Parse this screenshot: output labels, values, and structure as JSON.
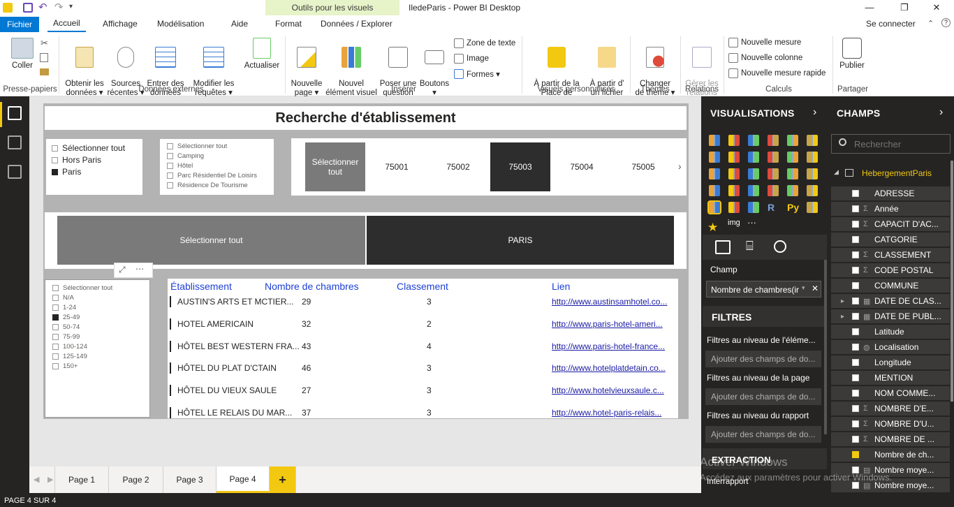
{
  "window": {
    "title": "IledeParis - Power BI Desktop",
    "sign_in": "Se connecter",
    "contextual_group": "Outils pour les visuels"
  },
  "ribbon_tabs": [
    "Fichier",
    "Accueil",
    "Affichage",
    "Modélisation",
    "Aide",
    "Format",
    "Données / Explorer"
  ],
  "ribbon": {
    "coller": "Coller",
    "obtenir": "Obtenir les\ndonnées ▾",
    "sources": "Sources\nrécentes ▾",
    "entrer": "Entrer des\ndonnées",
    "modifier": "Modifier les\nrequêtes ▾",
    "actualiser": "Actualiser",
    "nouvelle_page": "Nouvelle\npage ▾",
    "nouvel_element": "Nouvel\nélément visuel",
    "poser": "Poser une\nquestion",
    "boutons": "Boutons\n▾",
    "zone_texte": "Zone de texte",
    "image": "Image",
    "formes": "Formes ▾",
    "place_marche": "À partir de la\nPlace de marché",
    "fichier": "À partir d'\nun fichier",
    "changer_theme": "Changer\nde thème ▾",
    "gerer_relations": "Gérer les\nrelations",
    "nouvelle_mesure": "Nouvelle mesure",
    "nouvelle_colonne": "Nouvelle colonne",
    "mesure_rapide": "Nouvelle mesure rapide",
    "publier": "Publier",
    "groups": {
      "presse": "Presse-papiers",
      "donnees": "Données externes",
      "inserer": "Insérer",
      "visuels": "Visuels personnalisés",
      "themes": "Thèmes",
      "relations": "Relations",
      "calculs": "Calculs",
      "partager": "Partager"
    }
  },
  "report": {
    "title": "Recherche d'établissement",
    "slicer_zone": [
      "Sélectionner tout",
      "Hors Paris",
      "Paris"
    ],
    "slicer_type": [
      "Sélectionner tout",
      "Camping",
      "Hôtel",
      "Parc Résidentiel De Loisirs",
      "Résidence De Tourisme"
    ],
    "postal_buttons": [
      "Sélectionner tout",
      "75001",
      "75002",
      "75003",
      "75004",
      "75005"
    ],
    "city_buttons": [
      "Sélectionner tout",
      "PARIS"
    ],
    "slicer_rooms": [
      "Sélectionner tout",
      "N/A",
      "1-24",
      "25-49",
      "50-74",
      "75-99",
      "100-124",
      "125-149",
      "150+"
    ],
    "table": {
      "headers": [
        "Établissement",
        "Nombre de chambres",
        "Classement",
        "Lien"
      ],
      "rows": [
        {
          "name": "AUSTIN'S ARTS ET MϹTIER...",
          "rooms": "29",
          "rank": "3",
          "link": "http://www.austinsamhotel.co..."
        },
        {
          "name": "HOTEL AMERICAIN",
          "rooms": "32",
          "rank": "2",
          "link": "http://www.paris-hotel-ameri..."
        },
        {
          "name": "HÔTEL BEST WESTERN FRA...",
          "rooms": "43",
          "rank": "4",
          "link": "http://www.paris-hotel-france..."
        },
        {
          "name": "HÔTEL DU PLAT D'ϹTAIN",
          "rooms": "46",
          "rank": "3",
          "link": "http://www.hotelplatdetain.co..."
        },
        {
          "name": "HÔTEL DU VIEUX SAULE",
          "rooms": "27",
          "rank": "3",
          "link": "http://www.hotelvieuxsaule.c..."
        },
        {
          "name": "HÔTEL LE RELAIS DU MAR...",
          "rooms": "37",
          "rank": "3",
          "link": "http://www.hotel-paris-relais..."
        }
      ]
    }
  },
  "pages": [
    "Page 1",
    "Page 2",
    "Page 3",
    "Page 4"
  ],
  "add_page": "+",
  "status": "PAGE 4 SUR 4",
  "viz_pane": {
    "title": "VISUALISATIONS",
    "img_label": "img",
    "more": "···",
    "champ_label": "Champ",
    "champ_value": "Nombre de chambres(ir",
    "filters_title": "FILTRES",
    "filter_visual": "Filtres au niveau de l'éléme...",
    "filter_page": "Filtres au niveau de la page",
    "filter_report": "Filtres au niveau du rapport",
    "add_fields": "Ajouter des champs de do...",
    "extraction": "EXTRACTION",
    "interrapport": "Interrapport"
  },
  "fields_pane": {
    "title": "CHAMPS",
    "search_placeholder": "Rechercher",
    "table_name": "HebergementParis",
    "fields": [
      {
        "name": "ADRESSE",
        "sigma": "",
        "checked": false
      },
      {
        "name": "Année",
        "sigma": "Σ",
        "checked": false
      },
      {
        "name": "CAPACIT D'AC...",
        "sigma": "Σ",
        "checked": false
      },
      {
        "name": "CATGORIE",
        "sigma": "",
        "checked": false
      },
      {
        "name": "CLASSEMENT",
        "sigma": "Σ",
        "checked": false
      },
      {
        "name": "CODE POSTAL",
        "sigma": "Σ",
        "checked": false
      },
      {
        "name": "COMMUNE",
        "sigma": "",
        "checked": false
      },
      {
        "name": "DATE DE CLAS...",
        "sigma": "▦",
        "checked": false
      },
      {
        "name": "DATE DE PUBL...",
        "sigma": "▦",
        "checked": false
      },
      {
        "name": "Latitude",
        "sigma": "",
        "checked": false
      },
      {
        "name": "Localisation",
        "sigma": "◍",
        "checked": false
      },
      {
        "name": "Longitude",
        "sigma": "",
        "checked": false
      },
      {
        "name": "MENTION",
        "sigma": "",
        "checked": false
      },
      {
        "name": "NOM COMME...",
        "sigma": "",
        "checked": false
      },
      {
        "name": "NOMBRE D'E...",
        "sigma": "Σ",
        "checked": false
      },
      {
        "name": "NOMBRE D'U...",
        "sigma": "Σ",
        "checked": false
      },
      {
        "name": "NOMBRE DE ...",
        "sigma": "Σ",
        "checked": false
      },
      {
        "name": "Nombre de ch...",
        "sigma": "",
        "checked": true
      },
      {
        "name": "Nombre moye...",
        "sigma": "▤",
        "checked": false
      },
      {
        "name": "Nombre moye...",
        "sigma": "▤",
        "checked": false
      }
    ]
  },
  "watermark": {
    "line1": "Activer Windows",
    "line2": "Accédez aux paramètres pour activer Windows."
  }
}
